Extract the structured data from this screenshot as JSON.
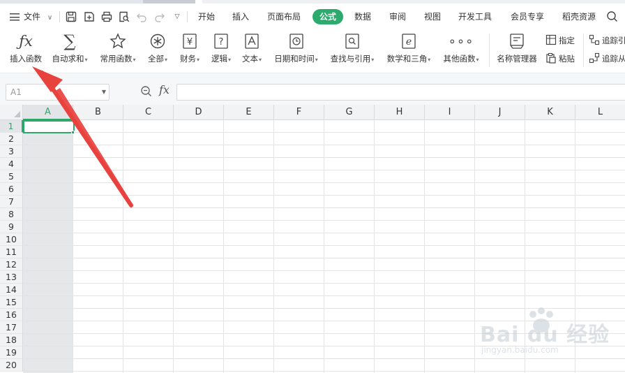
{
  "menubar": {
    "file_label": "文件",
    "tabs": [
      {
        "label": "开始",
        "active": false
      },
      {
        "label": "插入",
        "active": false
      },
      {
        "label": "页面布局",
        "active": false
      },
      {
        "label": "公式",
        "active": true
      },
      {
        "label": "数据",
        "active": false
      },
      {
        "label": "审阅",
        "active": false
      },
      {
        "label": "视图",
        "active": false
      },
      {
        "label": "开发工具",
        "active": false
      },
      {
        "label": "会员专享",
        "active": false
      },
      {
        "label": "稻壳资源",
        "active": false
      }
    ],
    "quick_icons": [
      "save-icon",
      "save-as-icon",
      "print-icon",
      "print-preview-icon",
      "undo-icon",
      "redo-icon",
      "more-icon"
    ]
  },
  "ribbon": {
    "buttons": [
      {
        "label": "插入函数",
        "icon": "fx-icon",
        "dropdown": false
      },
      {
        "label": "自动求和",
        "icon": "sigma-icon",
        "dropdown": true
      },
      {
        "label": "常用函数",
        "icon": "star-icon",
        "dropdown": true
      },
      {
        "label": "全部",
        "icon": "asterisk-icon",
        "dropdown": true
      },
      {
        "label": "财务",
        "icon": "yen-icon",
        "dropdown": true
      },
      {
        "label": "逻辑",
        "icon": "question-icon",
        "dropdown": true
      },
      {
        "label": "文本",
        "icon": "text-icon",
        "dropdown": true
      },
      {
        "label": "日期和时间",
        "icon": "clock-icon",
        "dropdown": true
      },
      {
        "label": "查找与引用",
        "icon": "lookup-icon",
        "dropdown": true
      },
      {
        "label": "数学和三角",
        "icon": "math-icon",
        "dropdown": true
      },
      {
        "label": "其他函数",
        "icon": "more-functions-icon",
        "dropdown": true
      },
      {
        "label": "名称管理器",
        "icon": "name-manager-icon",
        "dropdown": false
      }
    ],
    "small_buttons": [
      {
        "label": "指定",
        "icon": "specify-icon"
      },
      {
        "label": "粘贴",
        "icon": "paste-icon"
      },
      {
        "label": "追踪引",
        "icon": "trace-precedents-icon"
      },
      {
        "label": "追踪从",
        "icon": "trace-dependents-icon"
      }
    ]
  },
  "formula_bar": {
    "name_box": "A1",
    "fx_label": "fx",
    "formula": ""
  },
  "sheet": {
    "columns": [
      "A",
      "B",
      "C",
      "D",
      "E",
      "F",
      "G",
      "H",
      "I",
      "J",
      "K",
      "L"
    ],
    "rows": [
      "1",
      "2",
      "3",
      "4",
      "5",
      "6",
      "7",
      "8",
      "9",
      "10",
      "11",
      "12",
      "13",
      "14",
      "15",
      "16",
      "17",
      "18",
      "19",
      "20"
    ],
    "active_cell": "A1",
    "selected_column": "A",
    "selected_row": "1"
  },
  "colors": {
    "accent": "#2daa6d",
    "annotation_arrow": "#e8423e"
  },
  "watermark": {
    "text": "Bai du 经验",
    "sub": "jingyan.baidu.com"
  }
}
